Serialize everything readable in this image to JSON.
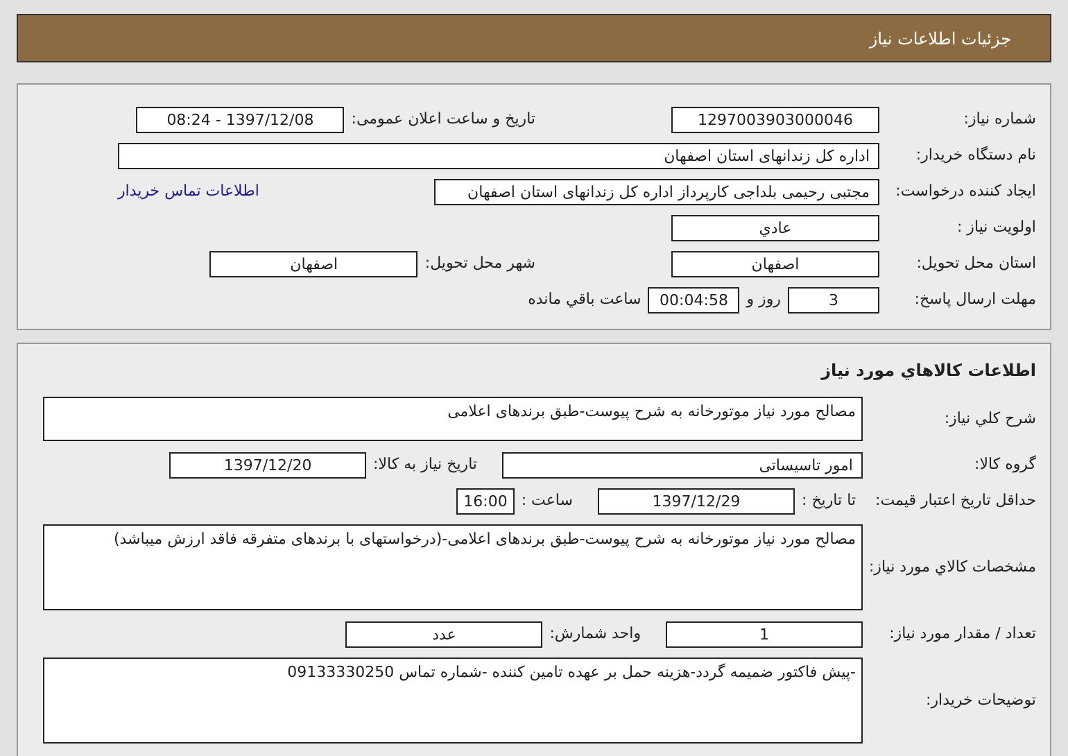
{
  "header": {
    "title": "جزئیات اطلاعات نیاز"
  },
  "details": {
    "rows": [
      {
        "label": "شماره نیاز:",
        "items": [
          {
            "kind": "field",
            "value": "1297003903000046"
          },
          {
            "kind": "label",
            "text": "تاریخ و ساعت اعلان عمومی:"
          },
          {
            "kind": "field",
            "value": "1397/12/08 - 08:24"
          }
        ]
      },
      {
        "label": "نام دستگاه خریدار:",
        "items": [
          {
            "kind": "wide",
            "value": "اداره کل زندانهای استان اصفهان"
          }
        ]
      },
      {
        "label": "ایجاد کننده درخواست:",
        "items": [
          {
            "kind": "wide",
            "value": "مجتبی رحیمی بلداجی کارپرداز اداره کل زندانهای استان اصفهان"
          },
          {
            "kind": "link",
            "text": "اطلاعات تماس خریدار"
          }
        ]
      },
      {
        "label": "اولویت نیاز :",
        "items": [
          {
            "kind": "field",
            "value": "عادي"
          }
        ]
      },
      {
        "label": "استان محل تحویل:",
        "items": [
          {
            "kind": "field",
            "value": "اصفهان"
          },
          {
            "kind": "label",
            "text": "شهر محل تحویل:"
          },
          {
            "kind": "field",
            "value": "اصفهان"
          }
        ]
      },
      {
        "label": "مهلت ارسال پاسخ:",
        "items": [
          {
            "kind": "tiny",
            "value": "3"
          },
          {
            "kind": "text",
            "text": "روز و"
          },
          {
            "kind": "tiny",
            "value": "00:04:58"
          },
          {
            "kind": "text",
            "text": "ساعت باقي مانده"
          }
        ]
      }
    ]
  },
  "goods": {
    "title": "اطلاعات کالاهاي مورد نیاز",
    "rows": [
      {
        "label": "شرح کلي نیاز:",
        "items": [
          {
            "kind": "area",
            "value": "مصالح مورد نیاز موتورخانه به شرح پیوست-طبق برندهای اعلامی"
          }
        ]
      },
      {
        "label": "گروه کالا:",
        "items": [
          {
            "kind": "medium",
            "value": "امور تاسیساتی"
          },
          {
            "kind": "label",
            "text": "تاریخ نیاز به کالا:"
          },
          {
            "kind": "field",
            "value": "1397/12/20"
          }
        ]
      },
      {
        "label": "حداقل تاریخ اعتبار قیمت:",
        "items": [
          {
            "kind": "text",
            "text": "تا تاریخ :"
          },
          {
            "kind": "field",
            "value": "1397/12/29"
          },
          {
            "kind": "label",
            "text": "ساعت :"
          },
          {
            "kind": "tiny",
            "value": "16:00"
          }
        ]
      },
      {
        "label": "مشخصات کالاي مورد نیاز:",
        "items": [
          {
            "kind": "tall",
            "value": "مصالح مورد نیاز موتورخانه به شرح پیوست-طبق برندهای اعلامی-(درخواستهای با برندهای متفرقه فاقد ارزش میباشد)"
          }
        ]
      },
      {
        "label": "تعداد / مقدار مورد نیاز:",
        "items": [
          {
            "kind": "field",
            "value": "1"
          },
          {
            "kind": "label",
            "text": "واحد شمارش:"
          },
          {
            "kind": "field",
            "value": "عدد"
          }
        ]
      },
      {
        "label": "توضیحات خریدار:",
        "items": [
          {
            "kind": "tall",
            "value": "-پیش فاکتور ضمیمه گردد-هزینه حمل بر عهده تامین کننده -شماره تماس 09133330250"
          }
        ]
      }
    ]
  }
}
